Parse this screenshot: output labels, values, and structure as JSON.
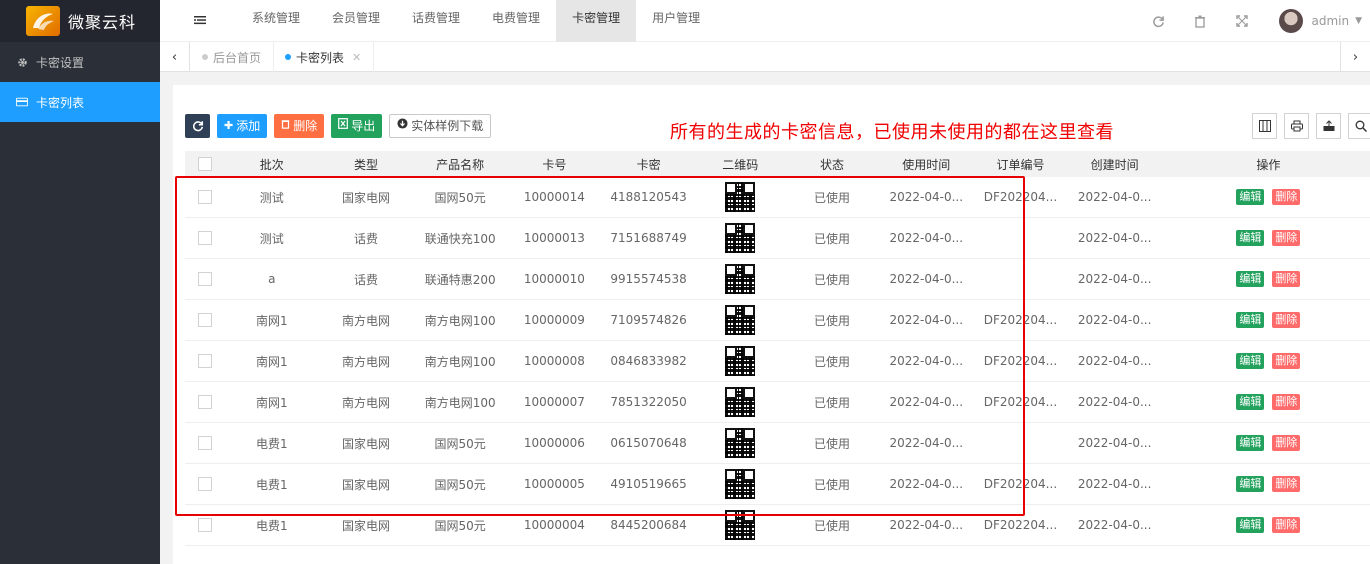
{
  "brand": {
    "name": "微聚云科"
  },
  "sidebar": {
    "items": [
      {
        "label": "卡密设置",
        "icon": "gear-icon"
      },
      {
        "label": "卡密列表",
        "icon": "card-icon"
      }
    ]
  },
  "topnav": {
    "tabs": [
      "系统管理",
      "会员管理",
      "话费管理",
      "电费管理",
      "卡密管理",
      "用户管理"
    ],
    "active": "卡密管理",
    "user": "admin"
  },
  "pagetabs": [
    {
      "label": "后台首页"
    },
    {
      "label": "卡密列表"
    }
  ],
  "toolbar": {
    "add": "添加",
    "delete": "删除",
    "export": "导出",
    "download": "实体样例下载"
  },
  "annotation": "所有的生成的卡密信息，已使用未使用的都在这里查看",
  "table": {
    "headers": {
      "batch": "批次",
      "type": "类型",
      "product": "产品名称",
      "card_no": "卡号",
      "password": "卡密",
      "qr": "二维码",
      "status": "状态",
      "used_time": "使用时间",
      "order_no": "订单编号",
      "created": "创建时间",
      "actions": "操作"
    },
    "edit_label": "编辑",
    "delete_label": "删除",
    "rows": [
      {
        "batch": "测试",
        "type": "国家电网",
        "product": "国网50元",
        "card_no": "10000014",
        "password": "4188120543",
        "status": "已使用",
        "used_time": "2022-04-0...",
        "order_no": "DF202204...",
        "created": "2022-04-0..."
      },
      {
        "batch": "测试",
        "type": "话费",
        "product": "联通快充100",
        "card_no": "10000013",
        "password": "7151688749",
        "status": "已使用",
        "used_time": "2022-04-0...",
        "order_no": "",
        "created": "2022-04-0..."
      },
      {
        "batch": "a",
        "type": "话费",
        "product": "联通特惠200",
        "card_no": "10000010",
        "password": "9915574538",
        "status": "已使用",
        "used_time": "2022-04-0...",
        "order_no": "",
        "created": "2022-04-0..."
      },
      {
        "batch": "南网1",
        "type": "南方电网",
        "product": "南方电网100",
        "card_no": "10000009",
        "password": "7109574826",
        "status": "已使用",
        "used_time": "2022-04-0...",
        "order_no": "DF202204...",
        "created": "2022-04-0..."
      },
      {
        "batch": "南网1",
        "type": "南方电网",
        "product": "南方电网100",
        "card_no": "10000008",
        "password": "0846833982",
        "status": "已使用",
        "used_time": "2022-04-0...",
        "order_no": "DF202204...",
        "created": "2022-04-0..."
      },
      {
        "batch": "南网1",
        "type": "南方电网",
        "product": "南方电网100",
        "card_no": "10000007",
        "password": "7851322050",
        "status": "已使用",
        "used_time": "2022-04-0...",
        "order_no": "DF202204...",
        "created": "2022-04-0..."
      },
      {
        "batch": "电费1",
        "type": "国家电网",
        "product": "国网50元",
        "card_no": "10000006",
        "password": "0615070648",
        "status": "已使用",
        "used_time": "2022-04-0...",
        "order_no": "",
        "created": "2022-04-0..."
      },
      {
        "batch": "电费1",
        "type": "国家电网",
        "product": "国网50元",
        "card_no": "10000005",
        "password": "4910519665",
        "status": "已使用",
        "used_time": "2022-04-0...",
        "order_no": "DF202204...",
        "created": "2022-04-0..."
      },
      {
        "batch": "电费1",
        "type": "国家电网",
        "product": "国网50元",
        "card_no": "10000004",
        "password": "8445200684",
        "status": "已使用",
        "used_time": "2022-04-0...",
        "order_no": "DF202204...",
        "created": "2022-04-0..."
      }
    ]
  }
}
